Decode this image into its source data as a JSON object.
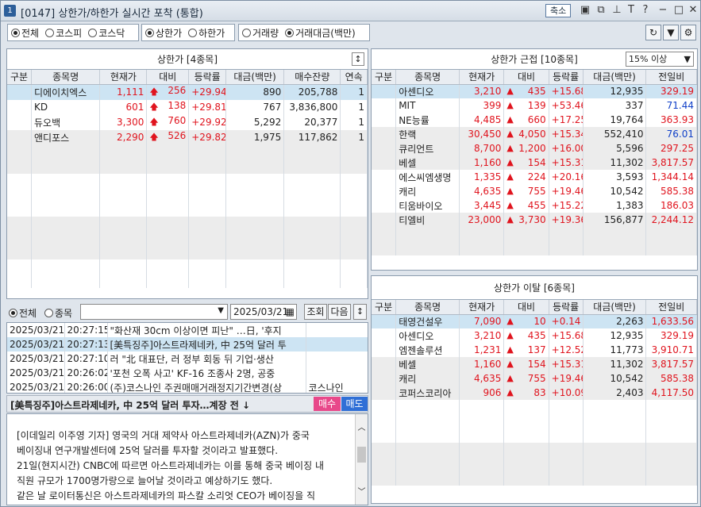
{
  "title": {
    "num": "1",
    "text": "[0147] 상한가/하한가 실시간 포착 (통합)",
    "shrink": "축소"
  },
  "filters": {
    "market": [
      "전체",
      "코스피",
      "코스닥"
    ],
    "limit": [
      "상한가",
      "하한가"
    ],
    "sort": [
      "거래량",
      "거래대금(백만)"
    ]
  },
  "upper": {
    "title": "상한가 [4종목]",
    "headers": [
      "구분",
      "종목명",
      "현재가",
      "대비",
      "등락률",
      "대금(백만)",
      "매수잔량",
      "연속"
    ],
    "rows": [
      [
        "",
        "디에이치엑스",
        "1,111",
        "256",
        "+29.94",
        "890",
        "205,788",
        "1"
      ],
      [
        "",
        "KD",
        "601",
        "138",
        "+29.81",
        "767",
        "3,836,800",
        "1"
      ],
      [
        "",
        "듀오백",
        "3,300",
        "760",
        "+29.92",
        "5,292",
        "20,377",
        "1"
      ],
      [
        "",
        "앤디포스",
        "2,290",
        "526",
        "+29.82",
        "1,975",
        "117,862",
        "1"
      ]
    ]
  },
  "near": {
    "title": "상한가 근접 [10종목]",
    "select": "15% 이상",
    "headers": [
      "구분",
      "종목명",
      "현재가",
      "대비",
      "등락률",
      "대금(백만)",
      "전일비"
    ],
    "rows": [
      [
        "",
        "아센디오",
        "3,210",
        "435",
        "+15.68",
        "12,935",
        "329.19",
        "r"
      ],
      [
        "",
        "MIT",
        "399",
        "139",
        "+53.46",
        "337",
        "71.44",
        "b"
      ],
      [
        "",
        "NE능률",
        "4,485",
        "660",
        "+17.25",
        "19,764",
        "363.93",
        "r"
      ],
      [
        "",
        "한랙",
        "30,450",
        "4,050",
        "+15.34",
        "552,410",
        "76.01",
        "b"
      ],
      [
        "",
        "큐리언트",
        "8,700",
        "1,200",
        "+16.00",
        "5,596",
        "297.25",
        "r"
      ],
      [
        "",
        "베셀",
        "1,160",
        "154",
        "+15.31",
        "11,302",
        "3,817.57",
        "r"
      ],
      [
        "",
        "에스씨엠생명",
        "1,335",
        "224",
        "+20.16",
        "3,593",
        "1,344.14",
        "r"
      ],
      [
        "",
        "캐리",
        "4,635",
        "755",
        "+19.46",
        "10,542",
        "585.38",
        "r"
      ],
      [
        "",
        "티움바이오",
        "3,445",
        "455",
        "+15.22",
        "1,383",
        "186.03",
        "r"
      ],
      [
        "",
        "티엘비",
        "23,000",
        "3,730",
        "+19.36",
        "156,877",
        "2,244.12",
        "r"
      ]
    ]
  },
  "depart": {
    "title": "상한가 이탈 [6종목]",
    "headers": [
      "구분",
      "종목명",
      "현재가",
      "대비",
      "등락률",
      "대금(백만)",
      "전일비"
    ],
    "rows": [
      [
        "",
        "태영건설우",
        "7,090",
        "10",
        "+0.14",
        "2,263",
        "1,633.56",
        "r"
      ],
      [
        "",
        "아센디오",
        "3,210",
        "435",
        "+15.68",
        "12,935",
        "329.19",
        "r"
      ],
      [
        "",
        "엠젠솔루션",
        "1,231",
        "137",
        "+12.52",
        "11,773",
        "3,910.71",
        "r"
      ],
      [
        "",
        "베셀",
        "1,160",
        "154",
        "+15.31",
        "11,302",
        "3,817.57",
        "r"
      ],
      [
        "",
        "캐리",
        "4,635",
        "755",
        "+19.46",
        "10,542",
        "585.38",
        "r"
      ],
      [
        "",
        "코퍼스코리아",
        "906",
        "83",
        "+10.09",
        "2,403",
        "4,117.50",
        "r"
      ]
    ]
  },
  "newsbar": {
    "all": "전체",
    "stock": "종목",
    "date": "2025/03/21",
    "query": "조회",
    "next": "다음"
  },
  "news": [
    [
      "2025/03/21",
      "20:27:15",
      "\"화산재 30cm 이상이면 피난\" …日, '후지",
      ""
    ],
    [
      "2025/03/21",
      "20:27:13",
      "[美특징주]아스트라제네카, 中 25억 달러 투",
      ""
    ],
    [
      "2025/03/21",
      "20:27:10",
      "러 \"北 대표단, 러 정부 회동 뒤 기업·생산",
      ""
    ],
    [
      "2025/03/21",
      "20:26:02",
      "'포천 오폭 사고' KF-16 조종사 2명, 공중",
      ""
    ],
    [
      "2025/03/21",
      "20:26:00",
      "(주)코스나인 주권매매거래정지기간변경(상",
      "코스나인"
    ]
  ],
  "article": {
    "headline": "[美특징주]아스트라제네카, 中 25억 달러 투자…계장 전 ↓",
    "buy": "매수",
    "sell": "매도",
    "body": [
      "[이데일리 이주영 기자] 영국의 거대 제약사 아스트라제네카(AZN)가 중국",
      "베이징내 연구개발센터에 25억 달러를 투자할 것이라고 발표했다.",
      "21일(현지시간) CNBC에 따르면 아스트라제네카는 이를 통해 중국 베이징 내",
      "직원 규모가 1700명가량으로 늘어날 것이라고 예상하기도 했다.",
      "같은 날 로이터통신은 아스트라제네카의 파스칼 소리엇 CEO가 베이징을 직"
    ]
  }
}
